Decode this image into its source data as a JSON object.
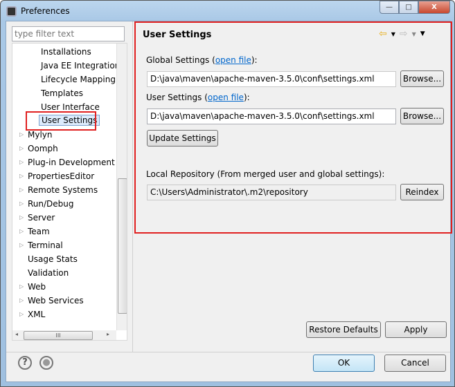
{
  "window": {
    "title": "Preferences",
    "minimize": "—",
    "maximize": "□",
    "close": "X"
  },
  "filter": {
    "placeholder": "type filter text"
  },
  "tree": {
    "items": [
      {
        "label": "Installations",
        "level": 2
      },
      {
        "label": "Java EE Integration",
        "level": 2
      },
      {
        "label": "Lifecycle Mapping",
        "level": 2
      },
      {
        "label": "Templates",
        "level": 2
      },
      {
        "label": "User Interface",
        "level": 2
      },
      {
        "label": "User Settings",
        "level": 2,
        "selected": true
      },
      {
        "label": "Mylyn",
        "level": 1,
        "expandable": true
      },
      {
        "label": "Oomph",
        "level": 1,
        "expandable": true
      },
      {
        "label": "Plug-in Development",
        "level": 1,
        "expandable": true
      },
      {
        "label": "PropertiesEditor",
        "level": 1,
        "expandable": true
      },
      {
        "label": "Remote Systems",
        "level": 1,
        "expandable": true
      },
      {
        "label": "Run/Debug",
        "level": 1,
        "expandable": true
      },
      {
        "label": "Server",
        "level": 1,
        "expandable": true
      },
      {
        "label": "Team",
        "level": 1,
        "expandable": true
      },
      {
        "label": "Terminal",
        "level": 1,
        "expandable": true
      },
      {
        "label": "Usage Stats",
        "level": 1
      },
      {
        "label": "Validation",
        "level": 1
      },
      {
        "label": "Web",
        "level": 1,
        "expandable": true
      },
      {
        "label": "Web Services",
        "level": 1,
        "expandable": true
      },
      {
        "label": "XML",
        "level": 1,
        "expandable": true
      }
    ]
  },
  "page": {
    "title": "User Settings",
    "global_label": "Global Settings (",
    "global_link": "open file",
    "global_close": "):",
    "global_value": "D:\\java\\maven\\apache-maven-3.5.0\\conf\\settings.xml",
    "user_label": "User Settings (",
    "user_link": "open file",
    "user_close": "):",
    "user_value": "D:\\java\\maven\\apache-maven-3.5.0\\conf\\settings.xml",
    "browse": "Browse...",
    "update": "Update Settings",
    "local_label": "Local Repository (From merged user and global settings):",
    "local_value": "C:\\Users\\Administrator\\.m2\\repository",
    "reindex": "Reindex",
    "restore": "Restore Defaults",
    "apply": "Apply"
  },
  "footer": {
    "ok": "OK",
    "cancel": "Cancel",
    "help": "?"
  },
  "colors": {
    "highlight": "#e02020",
    "link": "#0066cc"
  }
}
